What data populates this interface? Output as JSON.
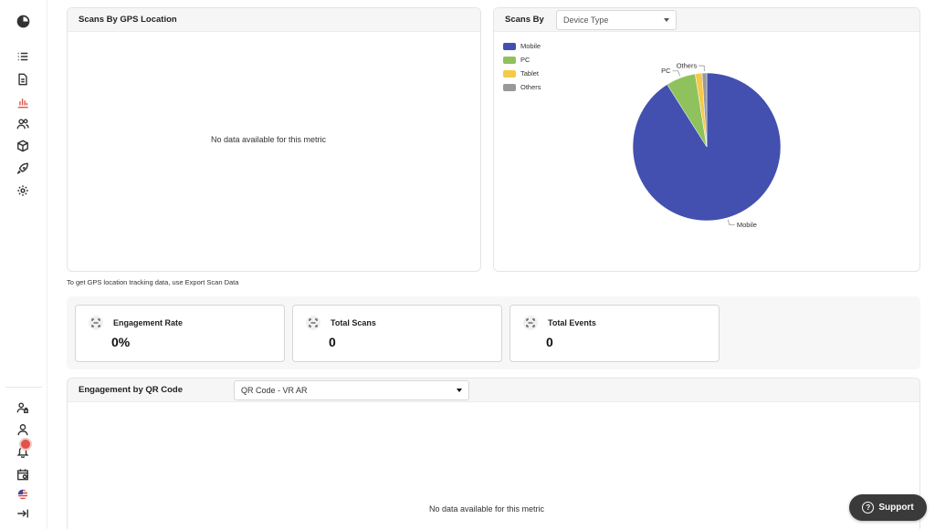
{
  "sidebar": {
    "icons": [
      "logo-icon",
      "list-icon",
      "document-icon",
      "analytics-icon",
      "users-icon",
      "box-icon",
      "rocket-icon",
      "settings-icon"
    ],
    "bottom_icons": [
      "user-admin-icon",
      "profile-icon",
      "notifications-icon",
      "calendar-icon",
      "us-flag-icon",
      "collapse-icon"
    ],
    "active_color": "#e0534a"
  },
  "gps_card": {
    "title": "Scans By GPS Location",
    "empty_message": "No data available for this metric",
    "hint": "To get GPS location tracking data, use Export Scan Data"
  },
  "scans_by_card": {
    "title": "Scans By",
    "select_value": "Device Type"
  },
  "chart_data": {
    "type": "pie",
    "categories": [
      "Mobile",
      "PC",
      "Tablet",
      "Others"
    ],
    "values": [
      91,
      6.5,
      1.5,
      1
    ],
    "colors": [
      "#4350af",
      "#8fc25d",
      "#f6c94a",
      "#999999"
    ],
    "legend_position": "top-left",
    "slice_labels": [
      "Mobile",
      "PC",
      "",
      "Others"
    ]
  },
  "metrics": [
    {
      "label": "Engagement Rate",
      "value": "0%"
    },
    {
      "label": "Total Scans",
      "value": "0"
    },
    {
      "label": "Total Events",
      "value": "0"
    }
  ],
  "engagement_card": {
    "title": "Engagement by QR Code",
    "select_value": "QR Code - VR AR",
    "empty_message": "No data available for this metric"
  },
  "support": {
    "label": "Support",
    "icon": "?"
  }
}
